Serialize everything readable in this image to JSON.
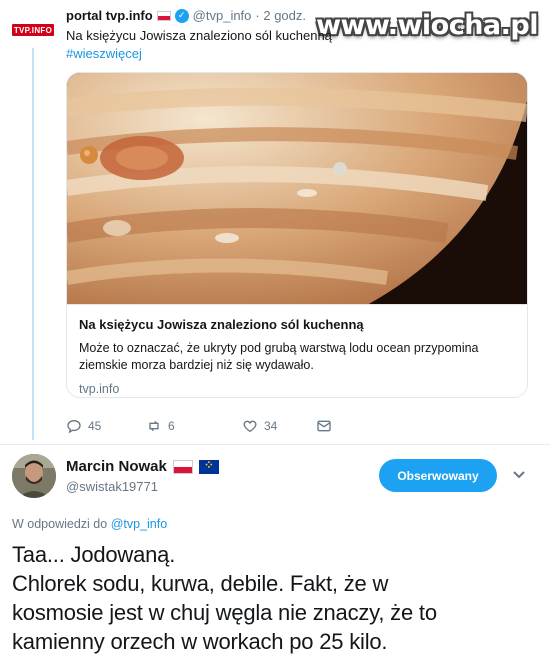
{
  "quoted_tweet": {
    "logo_text": "TVP.INFO",
    "author_name": "portal tvp.info",
    "author_handle": "@tvp_info",
    "time": "· 2 godz.",
    "text": "Na księżycu Jowisza znaleziono sól kuchenną",
    "hashtag": "#wieszwięcej",
    "card": {
      "title": "Na księżycu Jowisza znaleziono sól kuchenną",
      "description_line1": "Może to oznaczać, że ukryty pod grubą warstwą lodu ocean przypomina",
      "description_line2": "ziemskie morza bardziej niż się wydawało.",
      "domain": "tvp.info"
    },
    "actions": {
      "replies": "45",
      "retweets": "6",
      "likes": "34"
    }
  },
  "watermark": "www.wiocha.pl",
  "reply": {
    "author_name": "Marcin Nowak",
    "author_handle": "@swistak19771",
    "follow_label": "Obserwowany",
    "reply_prefix": "W odpowiedzi do",
    "reply_target": "@tvp_info",
    "text_lines": [
      "Taa... Jodowaną.",
      "Chlorek sodu, kurwa, debile. Fakt, że w",
      "kosmosie jest w chuj węgla nie znaczy, że to",
      "kamienny orzech w workach po 25 kilo."
    ]
  },
  "colors": {
    "accent": "#1da1f2",
    "link": "#1b95e0",
    "muted": "#657786",
    "thread_line": "#c4e2f7"
  },
  "icons": [
    "verified-badge-icon",
    "reply-icon",
    "retweet-icon",
    "like-icon",
    "dm-icon",
    "chevron-down-icon"
  ]
}
